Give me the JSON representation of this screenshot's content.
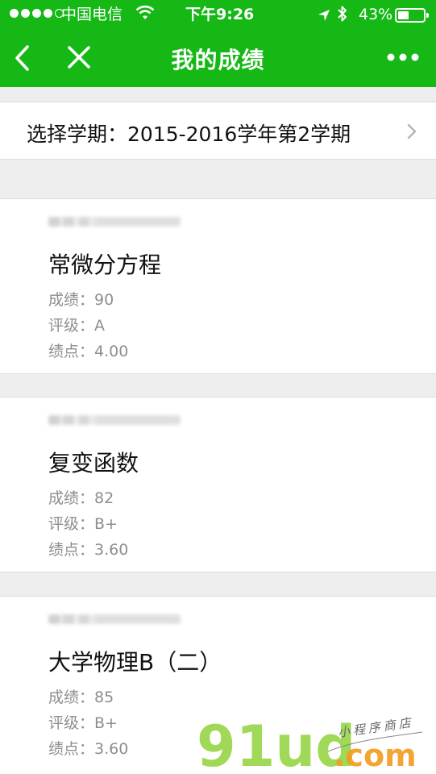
{
  "status_bar": {
    "carrier": "中国电信",
    "time": "下午9:26",
    "battery": "43%",
    "battery_level": 0.43
  },
  "nav": {
    "title": "我的成绩"
  },
  "term_selector": {
    "label": "选择学期：2015-2016学年第2学期"
  },
  "courses": [
    {
      "name": "常微分方程",
      "score": "成绩：90",
      "grade": "评级：A",
      "gpa": "绩点：4.00"
    },
    {
      "name": "复变函数",
      "score": "成绩：82",
      "grade": "评级：B+",
      "gpa": "绩点：3.60"
    },
    {
      "name": "大学物理B（二）",
      "score": "成绩：85",
      "grade": "评级：B+",
      "gpa": "绩点：3.60"
    }
  ],
  "watermark": {
    "logo": "91ud",
    "domain": ".com",
    "tagline": "小程序商店"
  },
  "colors": {
    "brand_green": "#16b816",
    "watermark_green": "#8fd13b",
    "watermark_orange": "#f39a1d"
  },
  "icons": {
    "back": "chevron-left-icon",
    "close": "close-icon",
    "more": "more-icon",
    "term_arrow": "chevron-right-icon"
  }
}
